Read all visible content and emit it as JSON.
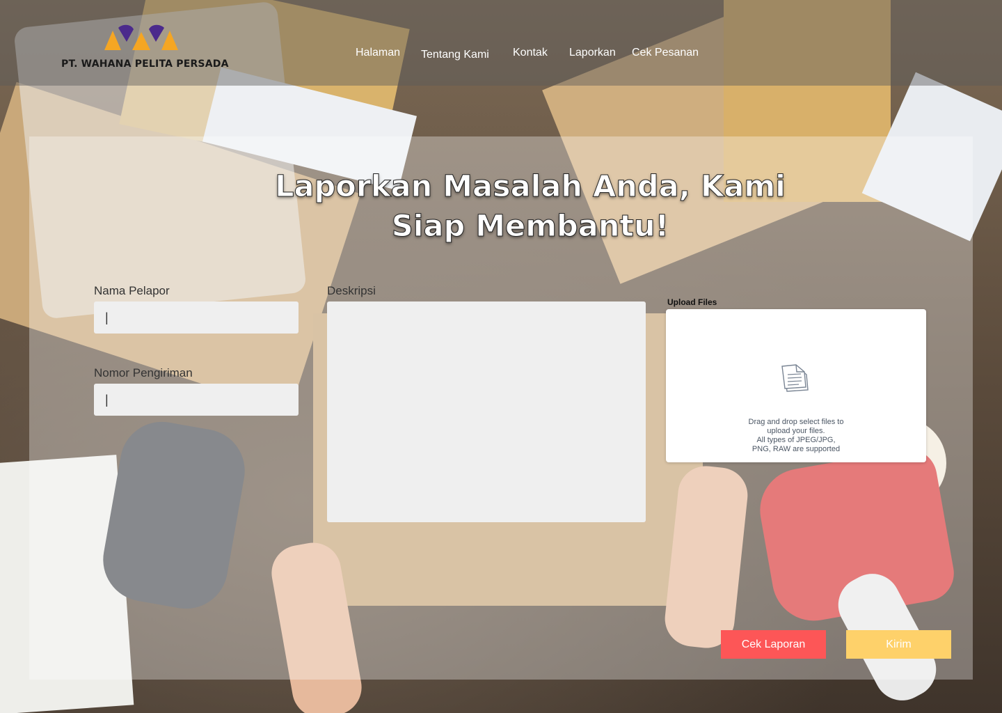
{
  "header": {
    "logo_text": "PT. WAHANA PELITA PERSADA",
    "nav": [
      {
        "label": "Halaman"
      },
      {
        "label": "Tentang Kami"
      },
      {
        "label": "Kontak"
      },
      {
        "label": "Laporkan"
      },
      {
        "label": "Cek Pesanan"
      }
    ]
  },
  "main": {
    "title": "Laporkan Masalah Anda, Kami Siap Membantu!",
    "form": {
      "nama_label": "Nama Pelapor",
      "nama_value": "|",
      "nomor_label": "Nomor Pengiriman",
      "nomor_value": "|",
      "deskripsi_label": "Deskripsi",
      "deskripsi_value": ""
    },
    "upload": {
      "label": "Upload Files",
      "line1": "Drag and drop select files to",
      "line2": "upload your files.",
      "line3": "All types of JPEG/JPG,",
      "line4": "PNG, RAW are supported",
      "icon": "document-icon"
    },
    "buttons": {
      "cek_label": "Cek Laporan",
      "kirim_label": "Kirim"
    }
  },
  "colors": {
    "cek_button": "#fd5657",
    "kirim_button": "#fed16a",
    "logo_orange": "#f5a623",
    "logo_purple": "#4b2a8c"
  }
}
